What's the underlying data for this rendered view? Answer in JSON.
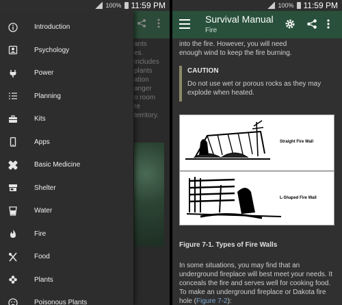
{
  "status_bar": {
    "battery": "100%",
    "time": "11:59 PM"
  },
  "background_screen": {
    "text_lines": [
      "ants",
      "es.",
      "includes",
      "plants",
      "ation",
      "anger",
      "o room",
      "re",
      "territory."
    ]
  },
  "drawer": {
    "items": [
      {
        "label": "Introduction",
        "icon": "info-icon"
      },
      {
        "label": "Psychology",
        "icon": "portrait-icon"
      },
      {
        "label": "Power",
        "icon": "power-plug-icon"
      },
      {
        "label": "Planning",
        "icon": "list-icon"
      },
      {
        "label": "Kits",
        "icon": "toolbox-icon"
      },
      {
        "label": "Apps",
        "icon": "phone-icon"
      },
      {
        "label": "Basic Medicine",
        "icon": "bandage-icon"
      },
      {
        "label": "Shelter",
        "icon": "store-icon"
      },
      {
        "label": "Water",
        "icon": "cup-icon"
      },
      {
        "label": "Fire",
        "icon": "flame-icon"
      },
      {
        "label": "Food",
        "icon": "utensils-icon"
      },
      {
        "label": "Plants",
        "icon": "flower-icon"
      },
      {
        "label": "Poisonous Plants",
        "icon": "sad-face-icon"
      }
    ]
  },
  "toolbar": {
    "title": "Survival Manual",
    "subtitle": "Fire"
  },
  "article": {
    "intro_line1": "into the fire. However, you will need",
    "intro_line2": "enough wind to keep the fire burning.",
    "caution_heading": "CAUTION",
    "caution_text": "Do not use wet or porous rocks as they may explode when heated.",
    "figure": {
      "label_top": "Straight Fire Wall",
      "label_bottom": "L-Shaped Fire Wall",
      "caption": "Figure 7-1. Types of Fire Walls"
    },
    "para_text": "In some situations, you may find that an underground fireplace will best meet your needs. It conceals the fire and serves well for cooking food. To make an underground fireplace or Dakota fire hole (",
    "para_link": "Figure 7-2",
    "para_end": "):"
  },
  "colors": {
    "toolbar": "#28503a",
    "drawer": "#2d2d2d",
    "link": "#7fa9d4"
  }
}
